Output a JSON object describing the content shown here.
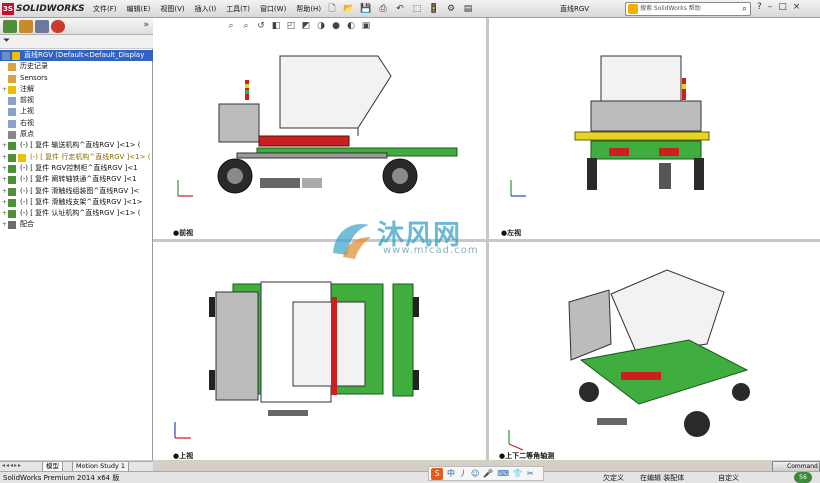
{
  "app": {
    "brand": "SOLIDWORKS",
    "document_title": "直线RGV"
  },
  "menu": [
    "文件(F)",
    "编辑(E)",
    "视图(V)",
    "插入(I)",
    "工具(T)",
    "窗口(W)",
    "帮助(H)"
  ],
  "search": {
    "placeholder": "搜索 SolidWorks 帮助"
  },
  "window_controls": [
    "?",
    "–",
    "□",
    "×"
  ],
  "feature_tree": {
    "root": "直线RGV  (Default<Default_Display",
    "items": [
      {
        "label": "历史记录",
        "kind": "folder"
      },
      {
        "label": "Sensors",
        "kind": "folder"
      },
      {
        "label": "注解",
        "kind": "annotation"
      },
      {
        "label": "前视",
        "kind": "plane"
      },
      {
        "label": "上视",
        "kind": "plane"
      },
      {
        "label": "右视",
        "kind": "plane"
      },
      {
        "label": "原点",
        "kind": "origin"
      },
      {
        "label": "(-) [ 复件 输送机构^直线RGV ]<1> (",
        "kind": "component"
      },
      {
        "label": "(-) [ 复件 行走机构^直线RGV ]<1> (",
        "kind": "component-warn"
      },
      {
        "label": "(-) [ 复件 RGV控制柜^直线RGV ]<1",
        "kind": "component"
      },
      {
        "label": "(-) [ 复件 阐转轴铁通^直线RGV ]<1",
        "kind": "component"
      },
      {
        "label": "(-) [ 复件 滑触线组装图^直线RGV ]<",
        "kind": "component"
      },
      {
        "label": "(-) [ 复件 滑触线支架^直线RGV ]<1>",
        "kind": "component"
      },
      {
        "label": "(-) [ 复件 认址机构^直线RGV ]<1> (",
        "kind": "component"
      },
      {
        "label": "配合",
        "kind": "mates"
      }
    ]
  },
  "bottom_tabs": [
    "模型",
    "Motion Study 1"
  ],
  "views": {
    "front": "●前视",
    "left": "●左视",
    "top": "●上视",
    "iso": "●上下二等角轴测"
  },
  "watermark": {
    "text": "沐风网",
    "url": "www.mfcad.com"
  },
  "status": {
    "edition": "SolidWorks Premium 2014 x64 版",
    "state1": "欠定义",
    "state2": "在编辑 装配体",
    "state3": "自定义"
  },
  "ime": {
    "glyphs": [
      "S",
      "中",
      "丿",
      "☺",
      "🎤",
      "⌨",
      "👕",
      "✂"
    ]
  },
  "command_tab": "Command",
  "badge": "56",
  "colors": {
    "selection": "#3163c5",
    "frame_green": "#3fae3f",
    "frame_yellow": "#e3d626",
    "accent_red": "#cc2020"
  }
}
